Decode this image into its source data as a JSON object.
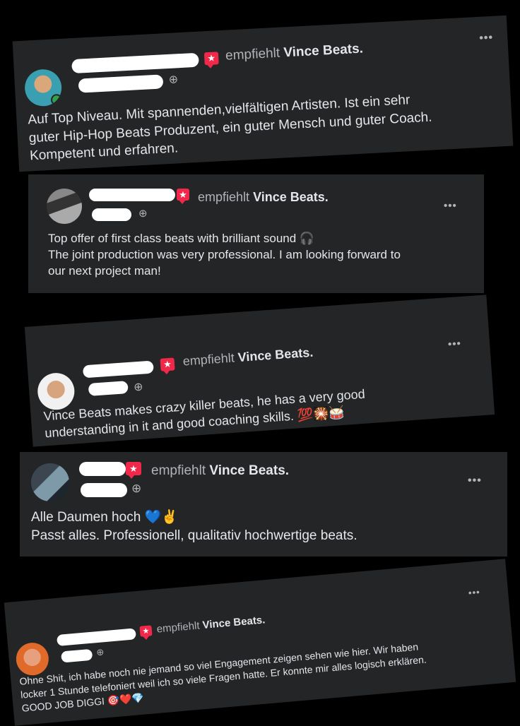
{
  "common": {
    "recommends": "empfiehlt",
    "page_name": "Vince Beats.",
    "more": "•••",
    "globe": "⊕",
    "dot": "·"
  },
  "reviews": [
    {
      "text_lines": [
        "Auf Top Niveau. Mit spannenden,vielfältigen Artisten. Ist ein sehr",
        "guter Hip-Hop Beats Produzent, ein guter Mensch und guter Coach.",
        "Kompetent und erfahren."
      ]
    },
    {
      "text_lines": [
        "Top offer of first class beats with brilliant sound 🎧",
        "The joint production was very professional. I am looking forward to",
        "our next project man!"
      ]
    },
    {
      "text_lines": [
        "Vince Beats makes crazy killer beats, he has a very good",
        "understanding in it and good coaching skills. 💯🎇🥁"
      ]
    },
    {
      "text_lines": [
        "Alle Daumen hoch 💙✌",
        "Passt alles. Professionell, qualitativ hochwertige beats."
      ]
    },
    {
      "text_lines": [
        "Ohne Shit, ich habe noch nie jemand so viel Engagement zeigen sehen wie hier.  Wir haben",
        "locker 1 Stunde telefoniert weil ich so viele Fragen hatte. Er konnte mir alles logisch erklären.",
        "GOOD JOB DIGGI 🎯❤️💎"
      ]
    }
  ],
  "colors": {
    "card_bg": "#242526",
    "text": "#e4e6eb",
    "muted": "#b0b3b8",
    "badge": "#f02849",
    "online": "#31a24c"
  }
}
